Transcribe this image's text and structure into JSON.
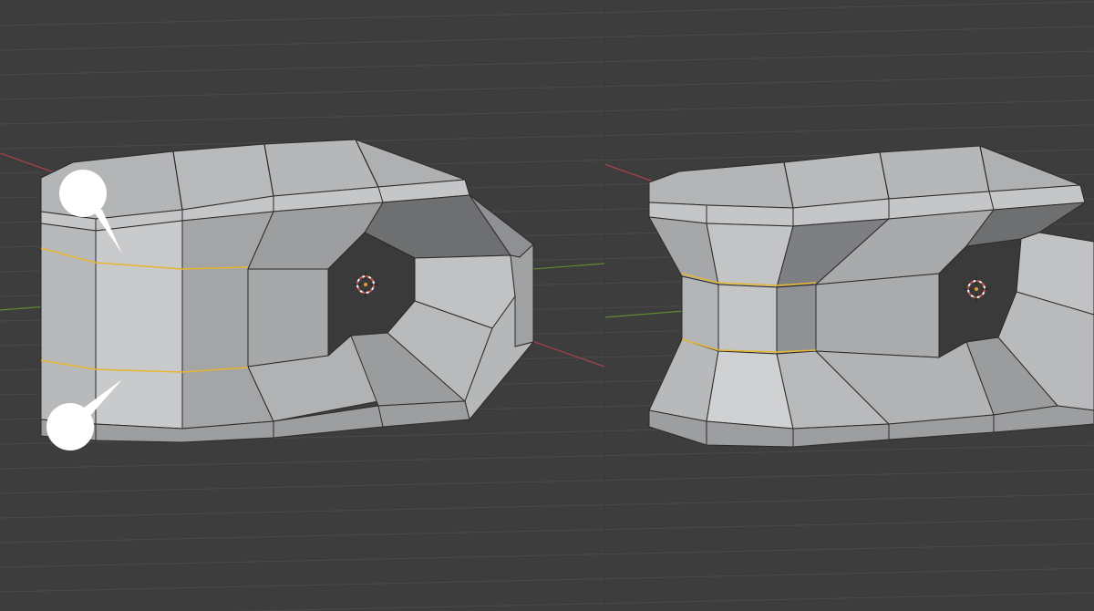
{
  "viewport": {
    "background": "#3d3d3d",
    "grid_color": "#4a4a4a",
    "x_axis_color": "#a8414b",
    "y_axis_color": "#5f8a2f",
    "face_color": "#a9abae",
    "face_light": "#c9cacc",
    "face_dark": "#7f8184",
    "edge_color": "#2c2c2c",
    "loop_cut_color": "#e8b530",
    "cursor_color": "#d9534f"
  },
  "panels": [
    {
      "name": "before-loop-scale",
      "annotation": "loop-cut-pointers"
    },
    {
      "name": "after-loop-scale"
    }
  ],
  "icons": [
    "3d-cursor-icon",
    "pointer-marker-icon"
  ]
}
